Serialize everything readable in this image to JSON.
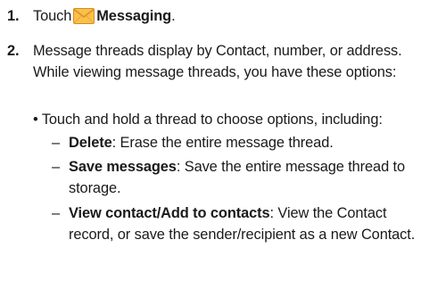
{
  "steps": [
    {
      "number": "1.",
      "prefix": "Touch",
      "icon": "envelope-icon",
      "app_name": "Messaging",
      "suffix": "."
    },
    {
      "number": "2.",
      "text": "Message threads display by Contact, number, or address. While viewing message threads, you have these options:"
    }
  ],
  "bullet": {
    "marker": "•",
    "text": "Touch and hold a thread to choose options, including:"
  },
  "options": [
    {
      "dash": "–",
      "label": "Delete",
      "desc": ": Erase the entire message thread."
    },
    {
      "dash": "–",
      "label": "Save messages",
      "desc": ": Save the entire message thread to storage."
    },
    {
      "dash": "–",
      "label": "View contact/Add to contacts",
      "desc": ": View the Contact record, or save the sender/recipient as a new Contact."
    }
  ],
  "colors": {
    "text": "#1a1a1a",
    "envelope_body": "#f7c24a",
    "envelope_flap": "#e8912b"
  }
}
